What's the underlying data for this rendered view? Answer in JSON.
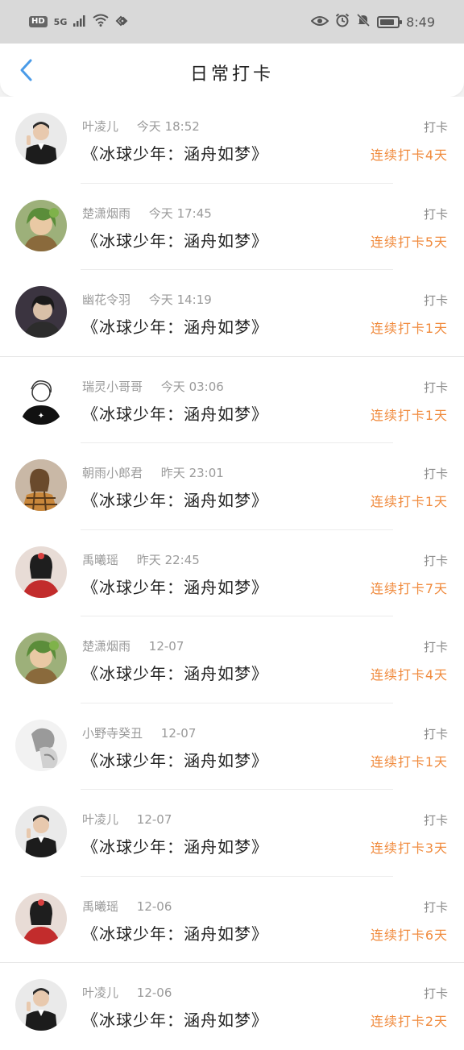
{
  "status_bar": {
    "hd": "HD",
    "signal": "5G",
    "time": "8:49",
    "icons": [
      "signal-icon",
      "wifi-icon",
      "eye-icon",
      "alarm-icon",
      "mute-icon",
      "battery-icon"
    ],
    "battery_level": 0.85
  },
  "header": {
    "title": "日常打卡",
    "back_icon": "chevron-left-icon",
    "accent": "#4a9be8"
  },
  "colors": {
    "streak": "#f08a3c",
    "meta": "#9a9a9a"
  },
  "checkins": [
    {
      "user": "叶凌儿",
      "time": "今天 18:52",
      "book": "《冰球少年：涵舟如梦》",
      "label": "打卡",
      "streak": "连续打卡4天",
      "avatar": "man-suit"
    },
    {
      "user": "楚潇烟雨",
      "time": "今天 17:45",
      "book": "《冰球少年：涵舟如梦》",
      "label": "打卡",
      "streak": "连续打卡5天",
      "avatar": "green-anime"
    },
    {
      "user": "幽花令羽",
      "time": "今天 14:19",
      "book": "《冰球少年：涵舟如梦》",
      "label": "打卡",
      "streak": "连续打卡1天",
      "avatar": "dark-hair"
    },
    {
      "user": "瑞灵小哥哥",
      "time": "今天 03:06",
      "book": "《冰球少年：涵舟如梦》",
      "label": "打卡",
      "streak": "连续打卡1天",
      "avatar": "sketch-boy"
    },
    {
      "user": "朝雨小郎君",
      "time": "昨天 23:01",
      "book": "《冰球少年：涵舟如梦》",
      "label": "打卡",
      "streak": "连续打卡1天",
      "avatar": "girl-plaid"
    },
    {
      "user": "禹曦瑶",
      "time": "昨天 22:45",
      "book": "《冰球少年：涵舟如梦》",
      "label": "打卡",
      "streak": "连续打卡7天",
      "avatar": "red-costume"
    },
    {
      "user": "楚潇烟雨",
      "time": "12-07",
      "book": "《冰球少年：涵舟如梦》",
      "label": "打卡",
      "streak": "连续打卡4天",
      "avatar": "green-anime"
    },
    {
      "user": "小野寺癸丑",
      "time": "12-07",
      "book": "《冰球少年：涵舟如梦》",
      "label": "打卡",
      "streak": "连续打卡1天",
      "avatar": "grey-sketch"
    },
    {
      "user": "叶凌儿",
      "time": "12-07",
      "book": "《冰球少年：涵舟如梦》",
      "label": "打卡",
      "streak": "连续打卡3天",
      "avatar": "man-suit"
    },
    {
      "user": "禹曦瑶",
      "time": "12-06",
      "book": "《冰球少年：涵舟如梦》",
      "label": "打卡",
      "streak": "连续打卡6天",
      "avatar": "red-costume"
    },
    {
      "user": "叶凌儿",
      "time": "12-06",
      "book": "《冰球少年：涵舟如梦》",
      "label": "打卡",
      "streak": "连续打卡2天",
      "avatar": "man-suit"
    }
  ]
}
